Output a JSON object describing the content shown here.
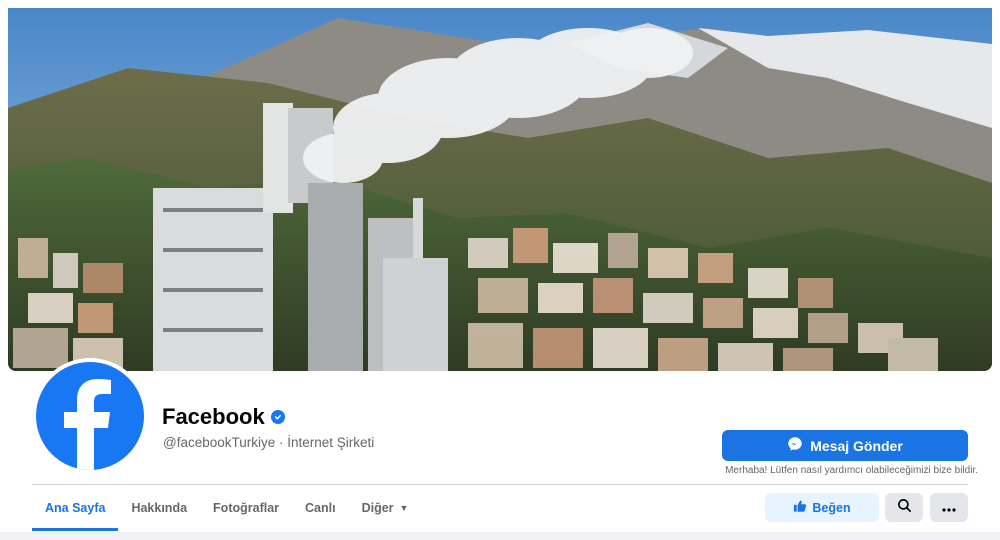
{
  "colors": {
    "brand": "#1877f2",
    "accent": "#1b74e4",
    "muted": "#65676b",
    "text": "#050505"
  },
  "page": {
    "name": "Facebook",
    "handle_line": "@facebookTurkiye · İnternet Şirketi",
    "verified_icon": "verified-check-icon"
  },
  "cover": {
    "alt": "industrial-town-cover-photo"
  },
  "actions": {
    "message_label": "Mesaj Gönder",
    "message_note": "Merhaba! Lütfen nasıl yardımcı olabileceğimizi bize bildir.",
    "like_label": "Beğen"
  },
  "tabs": [
    {
      "label": "Ana Sayfa",
      "active": true
    },
    {
      "label": "Hakkında"
    },
    {
      "label": "Fotoğraflar"
    },
    {
      "label": "Canlı"
    },
    {
      "label": "Diğer",
      "dropdown": true
    }
  ]
}
